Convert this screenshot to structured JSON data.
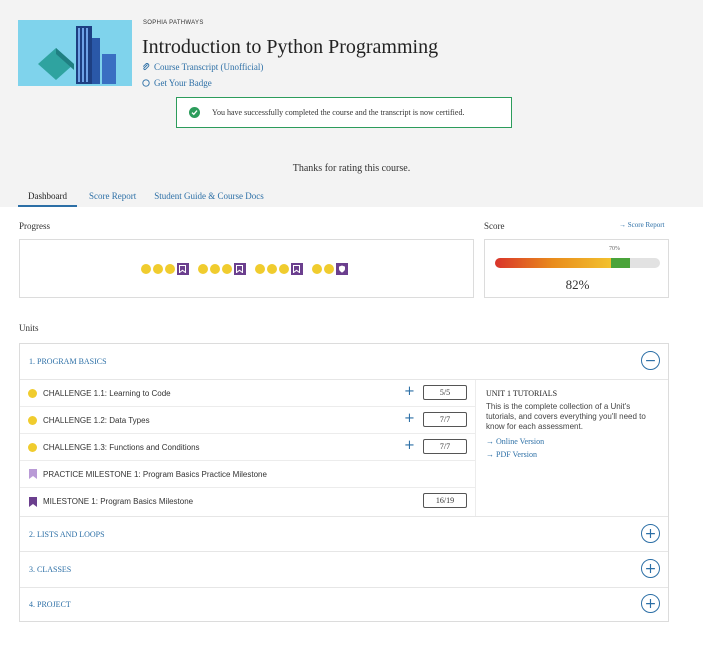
{
  "header": {
    "brand": "SOPHIA PATHWAYS",
    "title": "Introduction to Python Programming",
    "transcript_link": "Course Transcript (Unofficial)",
    "badge_link": "Get Your Badge",
    "success_message": "You have successfully completed the course and the transcript is now certified.",
    "thanks": "Thanks for rating this course."
  },
  "tabs": [
    {
      "label": "Dashboard",
      "active": true
    },
    {
      "label": "Score Report",
      "active": false
    },
    {
      "label": "Student Guide & Course Docs",
      "active": false
    }
  ],
  "progress": {
    "label": "Progress",
    "groups": [
      {
        "dots": 3,
        "end": "bookmark"
      },
      {
        "dots": 3,
        "end": "bookmark"
      },
      {
        "dots": 3,
        "end": "bookmark"
      },
      {
        "dots": 2,
        "end": "shield"
      }
    ],
    "dot_color": "#f0cc2e",
    "milestone_color": "#6b3f8e"
  },
  "score": {
    "label": "Score",
    "report_link": "→ Score Report",
    "threshold_label": "70%",
    "percent_text": "82%",
    "value": 82,
    "threshold": 70
  },
  "units_label": "Units",
  "units": [
    {
      "name": "1. PROGRAM BASICS",
      "expanded": true,
      "toggle": "−",
      "items": [
        {
          "type": "challenge",
          "label": "CHALLENGE 1.1: Learning to Code",
          "score": "5/5",
          "plus": "+"
        },
        {
          "type": "challenge",
          "label": "CHALLENGE 1.2: Data Types",
          "score": "7/7",
          "plus": "+"
        },
        {
          "type": "challenge",
          "label": "CHALLENGE 1.3: Functions and Conditions",
          "score": "7/7",
          "plus": "+"
        },
        {
          "type": "practice",
          "label": "PRACTICE MILESTONE 1: Program Basics Practice Milestone"
        },
        {
          "type": "milestone",
          "label": "MILESTONE 1: Program Basics Milestone",
          "score": "16/19"
        }
      ],
      "tutorials": {
        "heading": "UNIT 1 TUTORIALS",
        "description": "This is the complete collection of a Unit's tutorials, and covers everything you'll need to know for each assessment.",
        "online": "→ Online Version",
        "pdf": "→ PDF Version"
      }
    },
    {
      "name": "2. LISTS AND LOOPS",
      "expanded": false,
      "toggle": "+"
    },
    {
      "name": "3. CLASSES",
      "expanded": false,
      "toggle": "+"
    },
    {
      "name": "4. PROJECT",
      "expanded": false,
      "toggle": "+"
    }
  ]
}
